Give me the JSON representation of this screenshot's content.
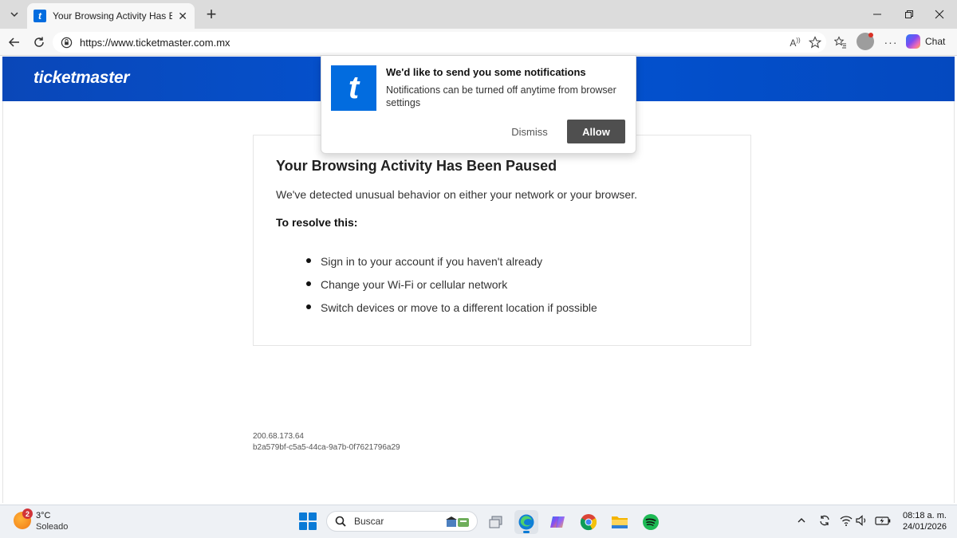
{
  "browser": {
    "tab": {
      "title": "Your Browsing Activity Has Been Paused",
      "favicon_letter": "t"
    },
    "new_tab_symbol": "+",
    "url": "https://www.ticketmaster.com.mx",
    "chat_label": "Chat"
  },
  "site": {
    "brand": "ticketmaster",
    "brand_color": "#026cdf"
  },
  "notification": {
    "logo_letter": "t",
    "title": "We'd like to send you some notifications",
    "message": "Notifications can be turned off anytime from browser settings",
    "dismiss_label": "Dismiss",
    "allow_label": "Allow"
  },
  "card": {
    "title": "Your Browsing Activity Has Been Paused",
    "description": "We've detected unusual behavior on either your network or your browser.",
    "subtitle": "To resolve this:",
    "steps": [
      "Sign in to your account if you haven't already",
      "Change your Wi-Fi or cellular network",
      "Switch devices or move to a different location if possible"
    ]
  },
  "footer": {
    "ip": "200.68.173.64",
    "request_id": "b2a579bf-c5a5-44ca-9a7b-0f7621796a29"
  },
  "taskbar": {
    "weather_badge": "2",
    "temperature": "3°C",
    "condition": "Soleado",
    "search_placeholder": "Buscar",
    "time": "08:18 a. m.",
    "date": "24/01/2026",
    "apps": [
      "task-view-icon",
      "edge-icon",
      "copilot-icon",
      "chrome-icon",
      "file-explorer-icon",
      "spotify-icon"
    ]
  }
}
